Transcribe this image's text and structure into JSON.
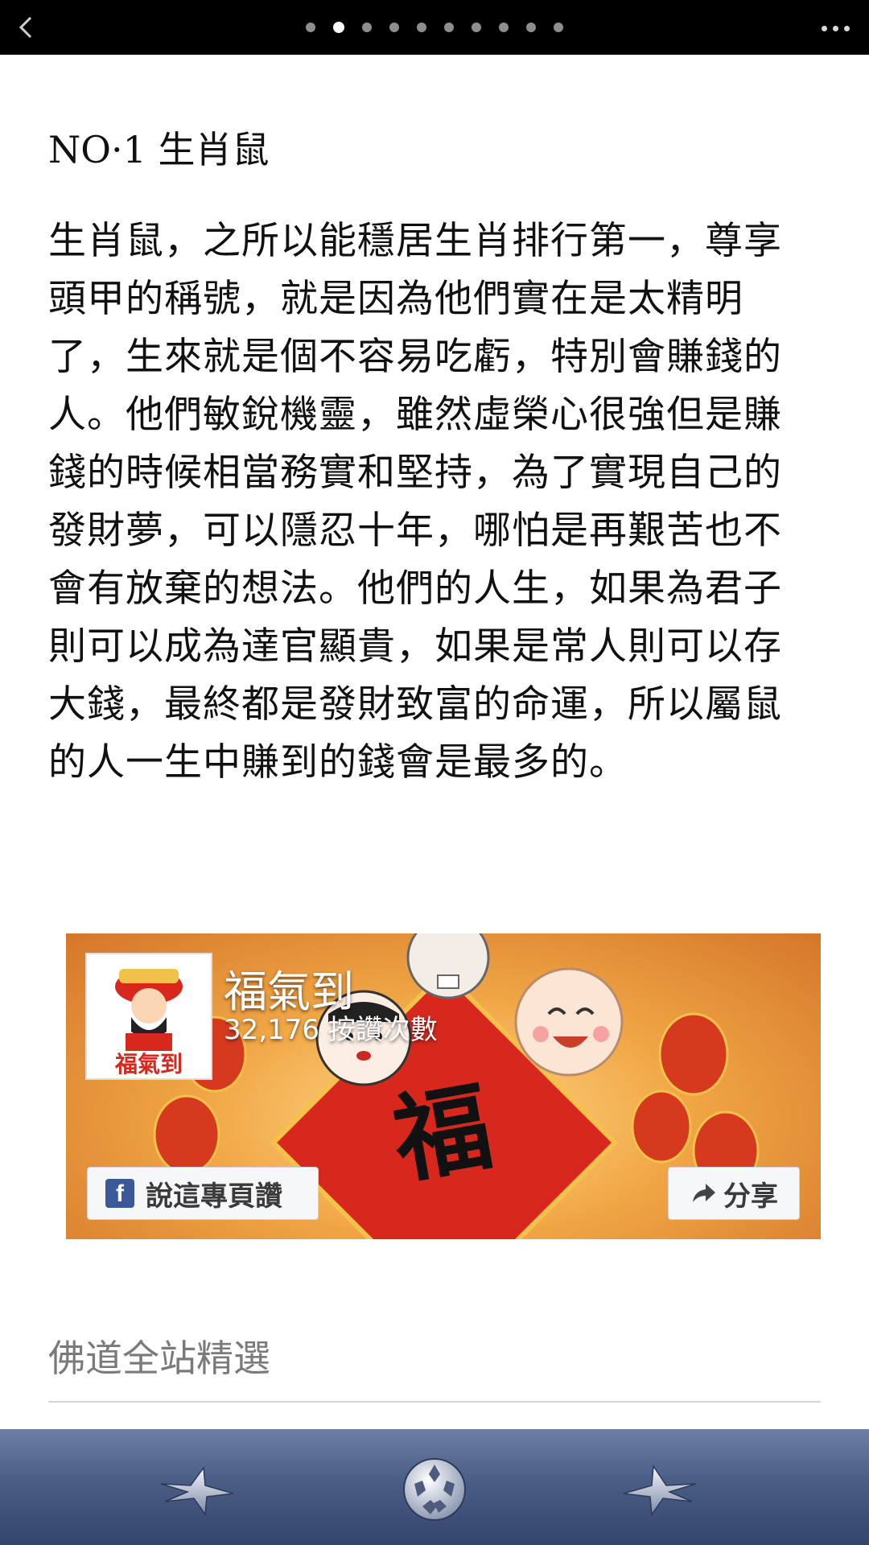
{
  "topbar": {
    "page_indicator": {
      "total": 10,
      "current": 2
    }
  },
  "article": {
    "title": "NO·1 生肖鼠",
    "body": "生肖鼠，之所以能穩居生肖排行第一，尊享頭甲的稱號，就是因為他們實在是太精明了，生來就是個不容易吃虧，特別會賺錢的人。他們敏銳機靈，雖然虛榮心很強但是賺錢的時候相當務實和堅持，為了實現自己的發財夢，可以隱忍十年，哪怕是再艱苦也不會有放棄的想法。他們的人生，如果為君子則可以成為達官顯貴，如果是常人則可以存大錢，最終都是發財致富的命運，所以屬鼠的人一生中賺到的錢會是最多的。"
  },
  "fb_widget": {
    "page_name": "福氣到",
    "logo_text": "福氣到",
    "like_count": "32,176 按讚次數",
    "like_button": "說這專頁讚",
    "share_button": "分享",
    "colors": {
      "fb_blue": "#3b5998",
      "banner_red": "#d8281e",
      "banner_orange": "#f1a746"
    }
  },
  "section": {
    "title": "佛道全站精選"
  },
  "bottom_nav": {
    "items": [
      {
        "icon": "star-left-icon"
      },
      {
        "icon": "ball-icon"
      },
      {
        "icon": "star-right-icon"
      }
    ]
  }
}
